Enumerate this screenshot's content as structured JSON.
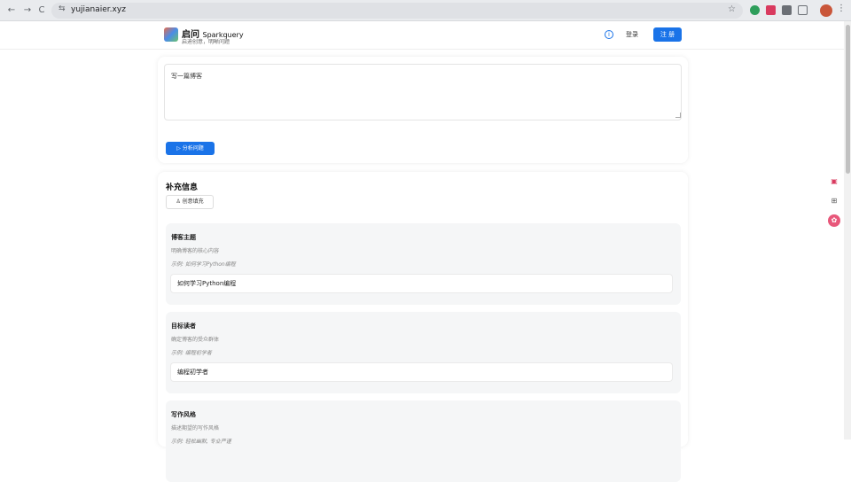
{
  "browser": {
    "url": "yujianaier.xyz",
    "back_glyph": "←",
    "forward_glyph": "→",
    "reload_glyph": "C",
    "tune_glyph": "⇆",
    "star_glyph": "☆",
    "menu_glyph": "⋮"
  },
  "header": {
    "brand_cn": "启问",
    "brand_en": "Sparkquery",
    "tagline": "启迪创意，明晰问题",
    "info_glyph": "i",
    "login_label": "登录",
    "register_label": "注 册",
    "accent_color": "#1a73e8"
  },
  "input_card": {
    "query_text": "写一篇博客",
    "analyze_label": "分析问题",
    "analyze_icon_glyph": "▷"
  },
  "supplement": {
    "title": "补充信息",
    "fill_label": "创意填充",
    "fill_icon_glyph": "♙",
    "fields": [
      {
        "label": "博客主题",
        "description": "明确博客的核心内容",
        "example": "示例: 如何学习Python编程",
        "value": "如何学习Python编程"
      },
      {
        "label": "目标读者",
        "description": "确定博客的受众群体",
        "example": "示例: 编程初学者",
        "value": "编程初学者"
      },
      {
        "label": "写作风格",
        "description": "描述期望的写作风格",
        "example": "示例: 轻松幽默, 专业严谨",
        "value": ""
      }
    ]
  },
  "side_tools": {
    "icon_1_glyph": "▣",
    "icon_2_glyph": "⊞",
    "icon_3_glyph": "✿"
  }
}
